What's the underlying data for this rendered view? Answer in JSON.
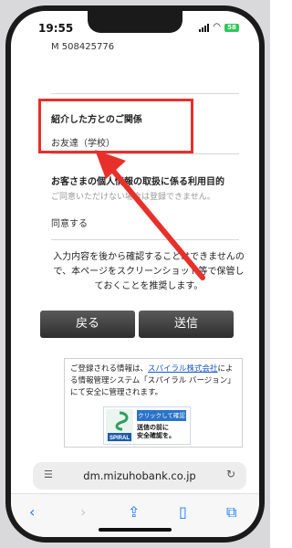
{
  "status": {
    "time": "19:55",
    "battery": "58"
  },
  "form": {
    "member_no": "M 508425776",
    "relation_label": "紹介した方とのご関係",
    "relation_value": "お友達（学校）",
    "purpose_label": "お客さまの個人情報の取扱に係る利用目的",
    "purpose_hint": "ご同意いただけない場合は登録できません。",
    "purpose_value": "同意する"
  },
  "notice": "入力内容を後から確認することはできませんので、本ページをスクリーンショット等で保管しておくことを推奨します。",
  "buttons": {
    "back": "戻る",
    "submit": "送信"
  },
  "info": {
    "pre": "ご登録される情報は、",
    "link": "スパイラル株式会社",
    "post": "による情報管理システム「スパイラル バージョン」にて安全に管理されます。",
    "badge_top": "クリックして確認 ▶",
    "badge_sub1": "送信の前に",
    "badge_sub2": "安全確認を。",
    "badge_logo": "SPIRAL"
  },
  "browser": {
    "url": "dm.mizuhobank.co.jp"
  },
  "colors": {
    "highlight": "#e8302a",
    "accent": "#1a7cff"
  }
}
